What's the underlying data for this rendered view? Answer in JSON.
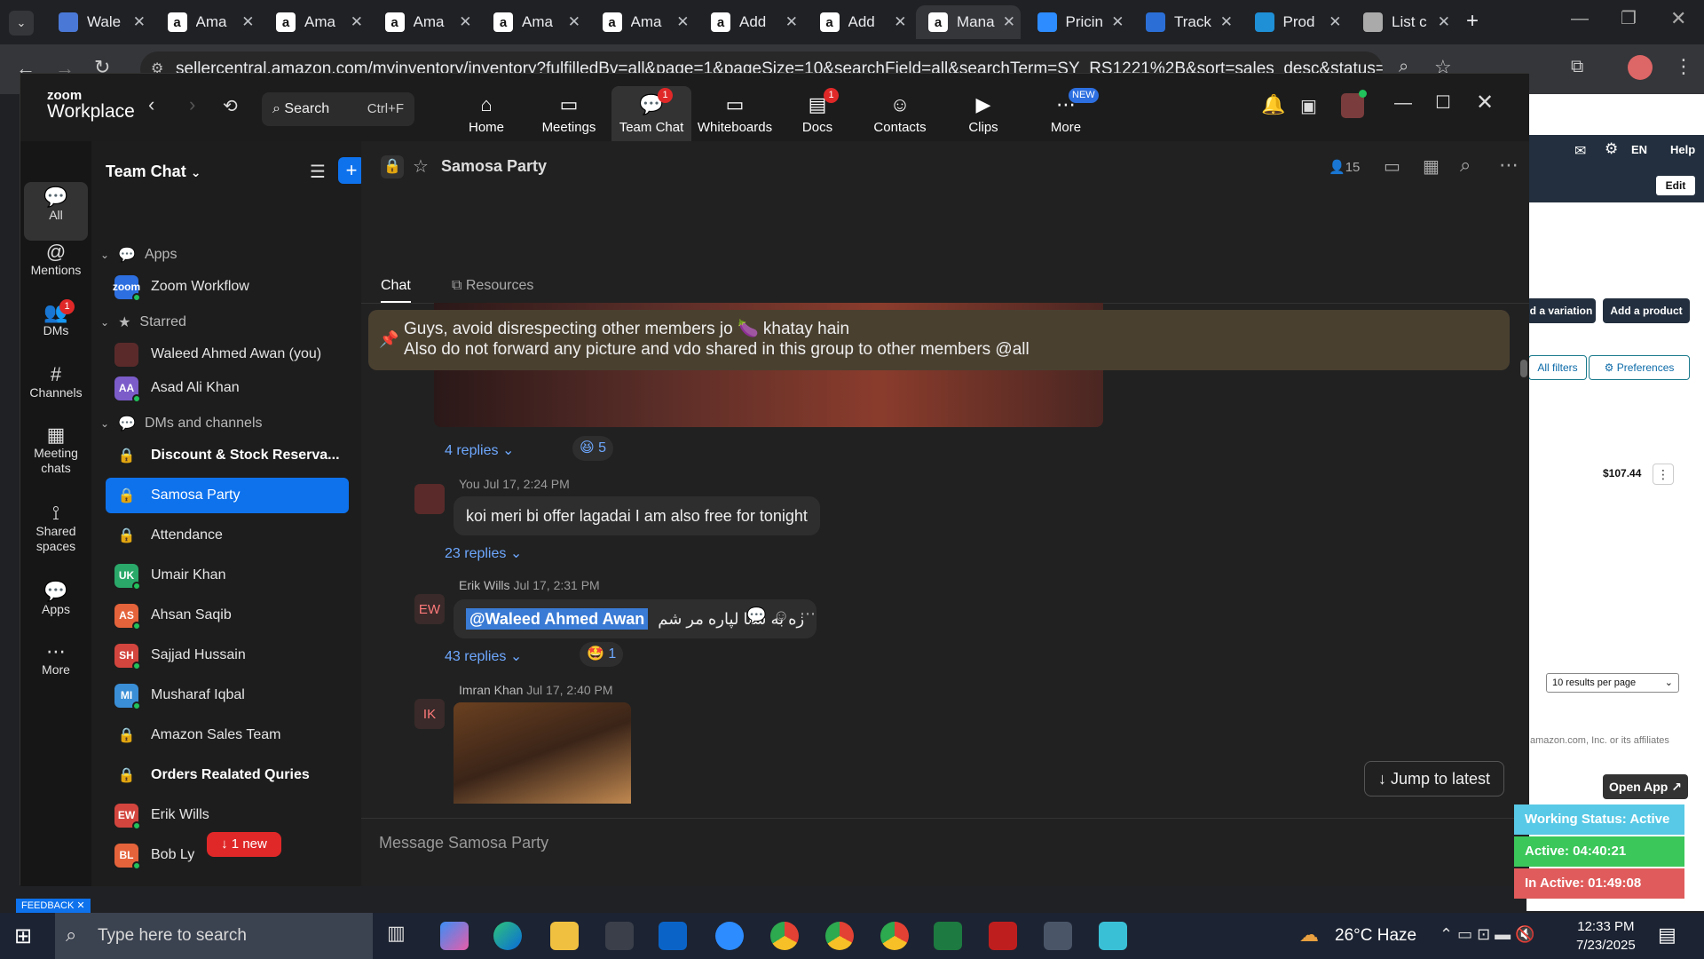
{
  "browser": {
    "tabs": [
      "Wale",
      "Ama",
      "Ama",
      "Ama",
      "Ama",
      "Ama",
      "Add",
      "Add",
      "Mana",
      "Pricin",
      "Track",
      "Prod",
      "List c"
    ],
    "url": "sellercentral.amazon.com/myinventory/inventory?fulfilledBy=all&page=1&pageSize=10&searchField=all&searchTerm=SY_RS1221%2B&sort=sales_desc&status=all&ref_=xx_i"
  },
  "seller": {
    "lang": "EN",
    "help": "Help",
    "edit": "Edit",
    "add_variation": "d a variation",
    "add_product": "Add a product",
    "all_filters": "All filters",
    "preferences": "Preferences",
    "price": "$107.44",
    "per_page": "10 results per page",
    "footer": "amazon.com, Inc. or its affiliates",
    "open_app": "Open App ↗"
  },
  "zoom": {
    "brand_top": "zoom",
    "brand_bottom": "Workplace",
    "search_label": "Search",
    "search_shortcut": "Ctrl+F",
    "nav": [
      {
        "label": "Home",
        "icon": "home-icon",
        "badge": ""
      },
      {
        "label": "Meetings",
        "icon": "video-icon",
        "badge": ""
      },
      {
        "label": "Team Chat",
        "icon": "chat-icon",
        "badge": "1"
      },
      {
        "label": "Whiteboards",
        "icon": "whiteboard-icon",
        "badge": ""
      },
      {
        "label": "Docs",
        "icon": "docs-icon",
        "badge": "1"
      },
      {
        "label": "Contacts",
        "icon": "contacts-icon",
        "badge": ""
      },
      {
        "label": "Clips",
        "icon": "clips-icon",
        "badge": ""
      },
      {
        "label": "More",
        "icon": "more-icon",
        "badge": "NEW"
      }
    ],
    "rail": [
      {
        "label": "All",
        "badge": ""
      },
      {
        "label": "Mentions",
        "badge": ""
      },
      {
        "label": "DMs",
        "badge": "1"
      },
      {
        "label": "Channels",
        "badge": ""
      },
      {
        "label": "Meeting chats",
        "badge": ""
      },
      {
        "label": "Shared spaces",
        "badge": ""
      },
      {
        "label": "Apps",
        "badge": ""
      },
      {
        "label": "More",
        "badge": ""
      }
    ],
    "sidebar": {
      "title": "Team Chat",
      "sections": [
        "Apps",
        "Starred",
        "DMs and channels"
      ],
      "apps": [
        {
          "name": "Zoom Workflow",
          "initials": "zoom"
        }
      ],
      "starred": [
        {
          "name": "Waleed Ahmed Awan (you)",
          "initials": ""
        },
        {
          "name": "Asad Ali Khan",
          "initials": "AA"
        }
      ],
      "items": [
        {
          "name": "Discount & Stock Reserva...",
          "initials": "",
          "bold": true
        },
        {
          "name": "Samosa Party",
          "initials": "",
          "selected": true
        },
        {
          "name": "Attendance",
          "initials": ""
        },
        {
          "name": "Umair Khan",
          "initials": "UK"
        },
        {
          "name": "Ahsan Saqib",
          "initials": "AS"
        },
        {
          "name": "Sajjad Hussain",
          "initials": "SH"
        },
        {
          "name": "Musharaf Iqbal",
          "initials": "MI"
        },
        {
          "name": "Amazon Sales Team",
          "initials": ""
        },
        {
          "name": "Orders Realated Quries",
          "initials": "",
          "bold": true
        },
        {
          "name": "Erik Wills",
          "initials": "EW"
        },
        {
          "name": "Bob Ly",
          "initials": "BL"
        }
      ],
      "new_pill": "↓ 1 new"
    },
    "chat": {
      "channel": "Samosa Party",
      "members": "15",
      "tabs": [
        "Chat",
        "Resources"
      ],
      "pinned_line1": "Guys, avoid disrespecting other members jo 🍆 khatay hain",
      "pinned_line2": "Also do not forward any picture and vdo shared in this group to other members @all",
      "img_replies": "4 replies",
      "img_reaction": "😆 5",
      "m1_meta_author": "You",
      "m1_meta_time": "Jul 17, 2:24 PM",
      "m1_text": "koi meri bi offer lagadai I am also free for tonight",
      "m1_replies": "23 replies",
      "m2_author": "Erik Wills",
      "m2_time": "Jul 17, 2:31 PM",
      "m2_initials": "EW",
      "m2_mention": "@Waleed Ahmed Awan",
      "m2_text": "زه به ستا لپاره مر شم",
      "m2_replies": "43 replies",
      "m2_reaction": "🤩 1",
      "m3_author": "Imran Khan",
      "m3_time": "Jul 17, 2:40 PM",
      "m3_initials": "IK",
      "jump": "Jump to latest",
      "composer_placeholder": "Message Samosa Party"
    }
  },
  "status": {
    "working": "Working Status: Active",
    "active": "Active: 04:40:21",
    "inactive": "In Active: 01:49:08"
  },
  "feedback": "FEEDBACK ✕",
  "taskbar": {
    "search": "Type here to search",
    "weather": "26°C  Haze",
    "time": "12:33 PM",
    "date": "7/23/2025"
  }
}
